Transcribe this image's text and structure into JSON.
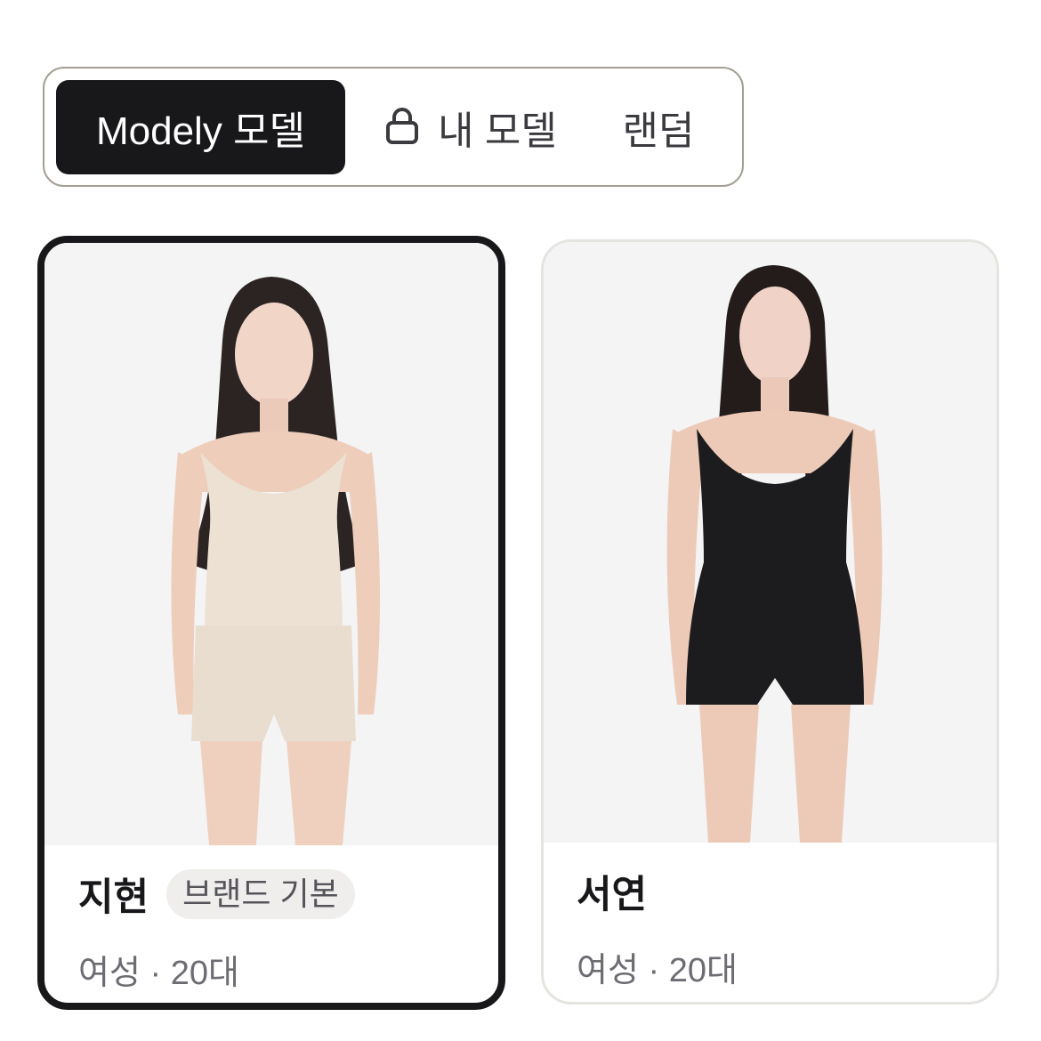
{
  "tabs": {
    "modely": "Modely 모델",
    "mine": "내 모델",
    "random": "랜덤"
  },
  "models": [
    {
      "name": "지현",
      "badge": "브랜드 기본",
      "meta": "여성 · 20대",
      "selected": true,
      "outfit": "beige camisole and shorts"
    },
    {
      "name": "서연",
      "meta": "여성 · 20대",
      "selected": false,
      "outfit": "black scoop-neck romper"
    }
  ],
  "colors": {
    "active_tab": "#18181b",
    "tab_border": "#a49f95",
    "card_selected_border": "#18181b",
    "card_border": "#e6e4e0",
    "badge_bg": "#efeeec"
  }
}
